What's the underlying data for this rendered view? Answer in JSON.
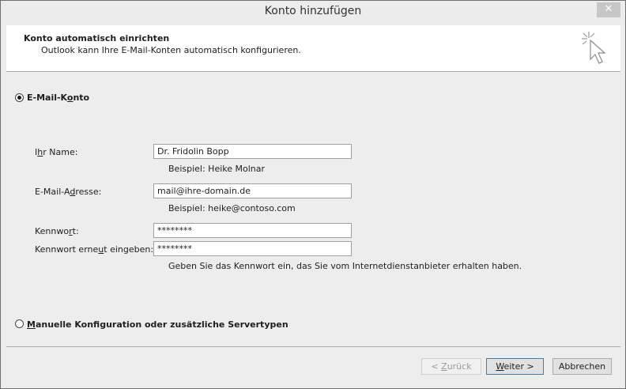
{
  "window": {
    "title": "Konto hinzufügen",
    "close_glyph": "✕"
  },
  "header": {
    "title": "Konto automatisch einrichten",
    "subtitle": "Outlook kann Ihre E-Mail-Konten automatisch konfigurieren.",
    "icon": "wizard-cursor-icon"
  },
  "email_account": {
    "radio": {
      "label_pre": "E-Mail-K",
      "label_mnemonic": "o",
      "label_post": "nto",
      "selected": true
    }
  },
  "fields": {
    "name": {
      "label_pre": "I",
      "label_mnemonic": "h",
      "label_post": "r Name:",
      "value": "Dr. Fridolin Bopp",
      "hint": "Beispiel: Heike Molnar"
    },
    "email": {
      "label_pre": "E-Mail-A",
      "label_mnemonic": "d",
      "label_post": "resse:",
      "value": "mail@ihre-domain.de",
      "hint": "Beispiel: heike@contoso.com"
    },
    "password": {
      "label_pre": "Kennwo",
      "label_mnemonic": "r",
      "label_post": "t:",
      "value": "********"
    },
    "password_confirm": {
      "label_pre": "Kennwort erne",
      "label_mnemonic": "u",
      "label_post": "t eingeben:",
      "value": "********",
      "hint": "Geben Sie das Kennwort ein, das Sie vom Internetdienstanbieter erhalten haben."
    }
  },
  "manual": {
    "radio": {
      "label_pre": "",
      "label_mnemonic": "M",
      "label_post": "anuelle Konfiguration oder zusätzliche Servertypen",
      "selected": false
    }
  },
  "buttons": {
    "back": {
      "label_pre": "< ",
      "label_mnemonic": "Z",
      "label_post": "urück",
      "enabled": false
    },
    "next": {
      "label_pre": "",
      "label_mnemonic": "W",
      "label_post": "eiter >",
      "enabled": true
    },
    "cancel": {
      "label": "Abbrechen",
      "enabled": true
    }
  }
}
